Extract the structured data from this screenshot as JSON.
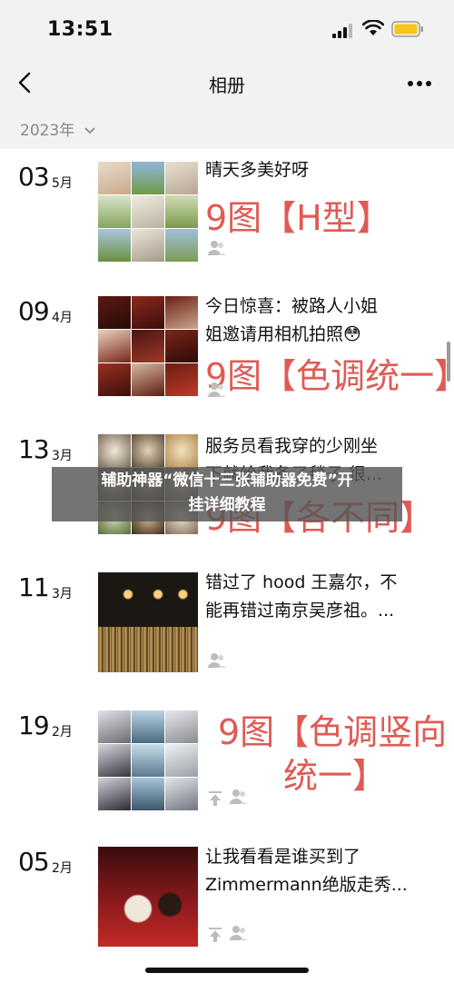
{
  "status_bar": {
    "time": "13:51"
  },
  "nav": {
    "title": "相册"
  },
  "year_header": {
    "label": "2023年"
  },
  "entries": [
    {
      "day": "03",
      "month": "5月",
      "caption": [
        "晴天多美好呀"
      ],
      "big_text": "9图【H型】",
      "theme": "portrait"
    },
    {
      "day": "09",
      "month": "4月",
      "caption": [
        "今日惊喜：被路人小姐",
        "姐邀请用相机拍照😳"
      ],
      "big_text": "9图【色调统一】",
      "theme": "dark-red"
    },
    {
      "day": "13",
      "month": "3月",
      "caption": [
        "服务员看我穿的少刚坐",
        "下就给我备了毯子 很..."
      ],
      "big_text": "9图【各不同】",
      "theme": "food"
    },
    {
      "day": "11",
      "month": "3月",
      "caption": [
        "错过了 hood 王嘉尔，不",
        "能再错过南京吴彦祖。..."
      ],
      "big_text": "",
      "theme": "bar"
    },
    {
      "day": "19",
      "month": "2月",
      "caption": [],
      "big_text_lines": [
        "9图【色调竖向",
        "统一】"
      ],
      "theme": "cool"
    },
    {
      "day": "05",
      "month": "2月",
      "caption": [
        "让我看看是谁买到了",
        "Zimmermann绝版走秀..."
      ],
      "big_text": "",
      "theme": "christmas"
    }
  ],
  "overlay": {
    "line1": "辅助神器“微信十三张辅助器免费”开",
    "line2": "挂详细教程"
  },
  "colors": {
    "accent_red": "#e05a55",
    "bar_bg": "#f2f2f2",
    "battery": "#f5c518"
  }
}
